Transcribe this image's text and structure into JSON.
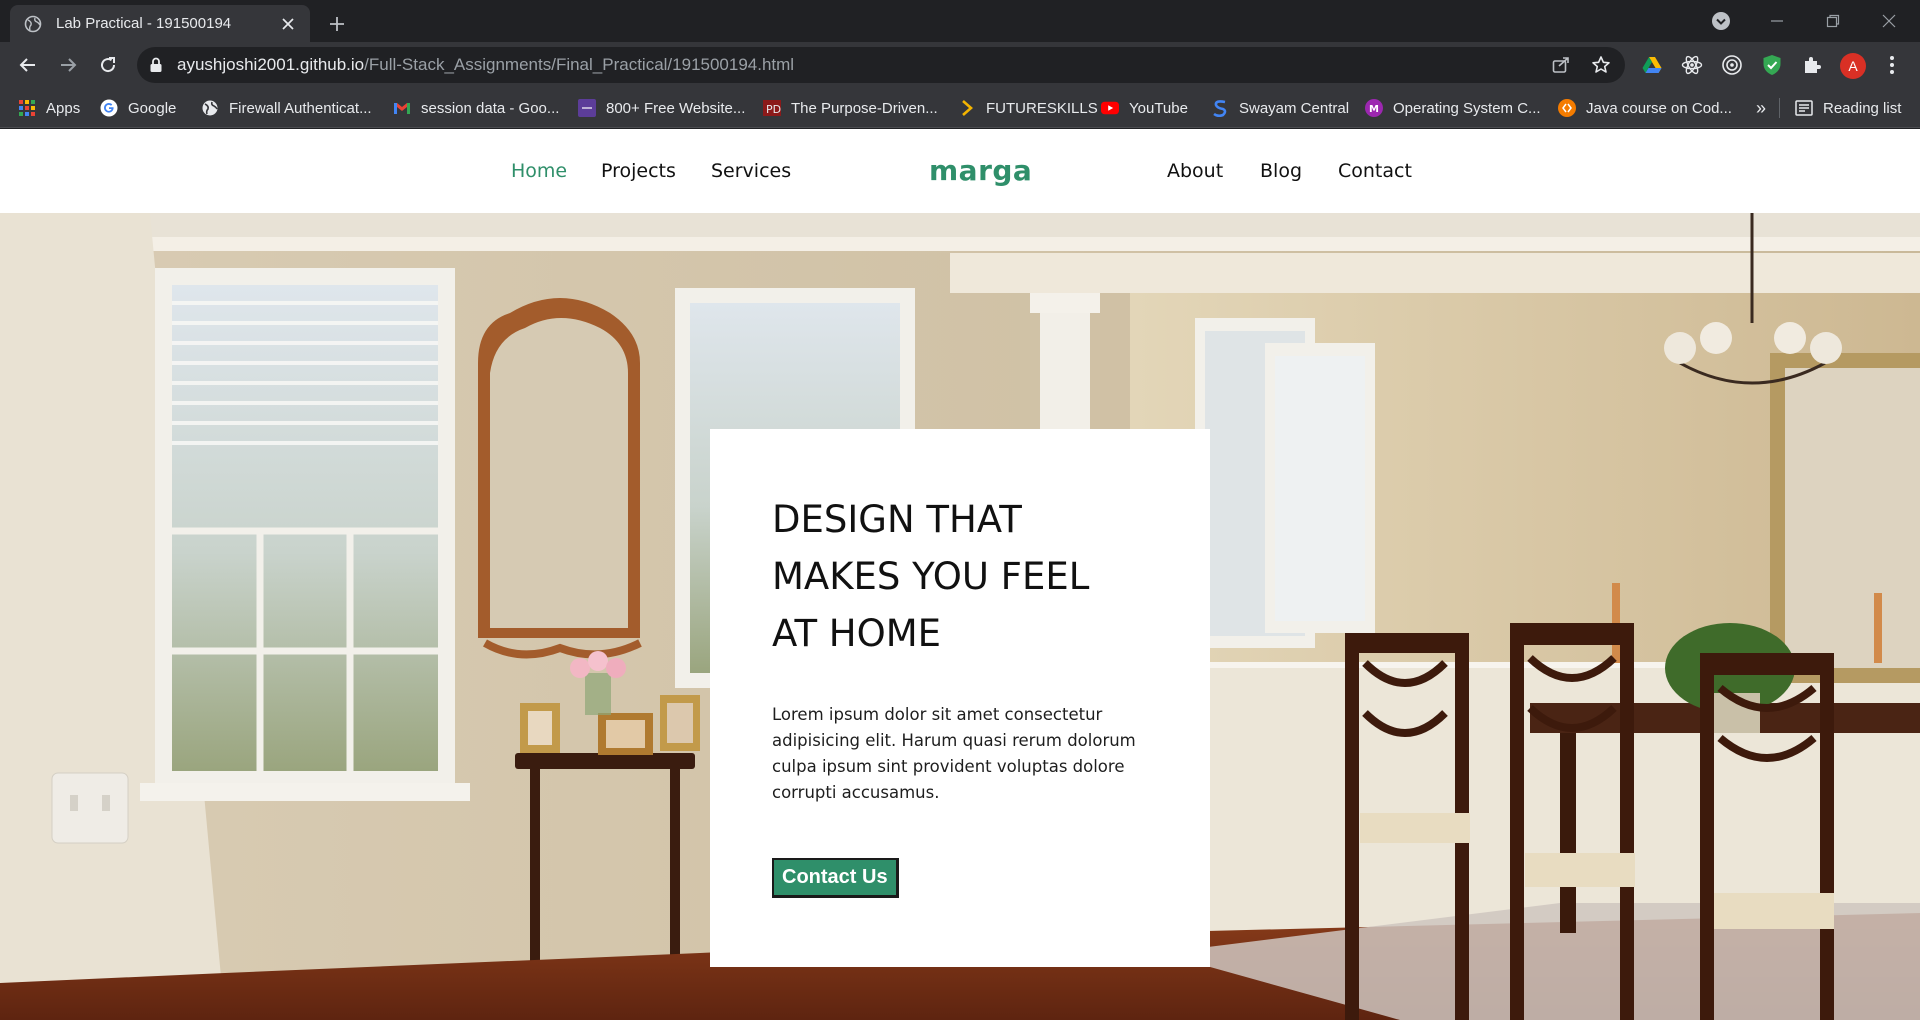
{
  "tab": {
    "title": "Lab Practical - 191500194"
  },
  "address_bar": {
    "host": "ayushjoshi2001.github.io",
    "path": "/Full-Stack_Assignments/Final_Practical/191500194.html"
  },
  "profile": {
    "initial": "A"
  },
  "bookmarks": {
    "items": [
      "Apps",
      "Google",
      "Firewall Authenticat...",
      "session data - Goo...",
      "800+ Free Website...",
      "The Purpose-Driven...",
      "FUTURESKILLS",
      "YouTube",
      "Swayam Central",
      "Operating System C...",
      "Java course on Cod..."
    ],
    "overflow": "»",
    "reading_list": "Reading list"
  },
  "site": {
    "brand": "marga",
    "nav_left": [
      "Home",
      "Projects",
      "Services"
    ],
    "nav_right": [
      "About",
      "Blog",
      "Contact"
    ],
    "hero": {
      "title": "DESIGN THAT MAKES YOU FEEL AT HOME",
      "body": "Lorem ipsum dolor sit amet consectetur adipisicing elit. Harum quasi rerum dolorum culpa ipsum sint provident voluptas dolore corrupti accusamus.",
      "cta": "Contact Us"
    }
  },
  "colors": {
    "accent": "#2f8f6a",
    "chrome_dark": "#202124",
    "chrome_toolbar": "#35363a"
  }
}
